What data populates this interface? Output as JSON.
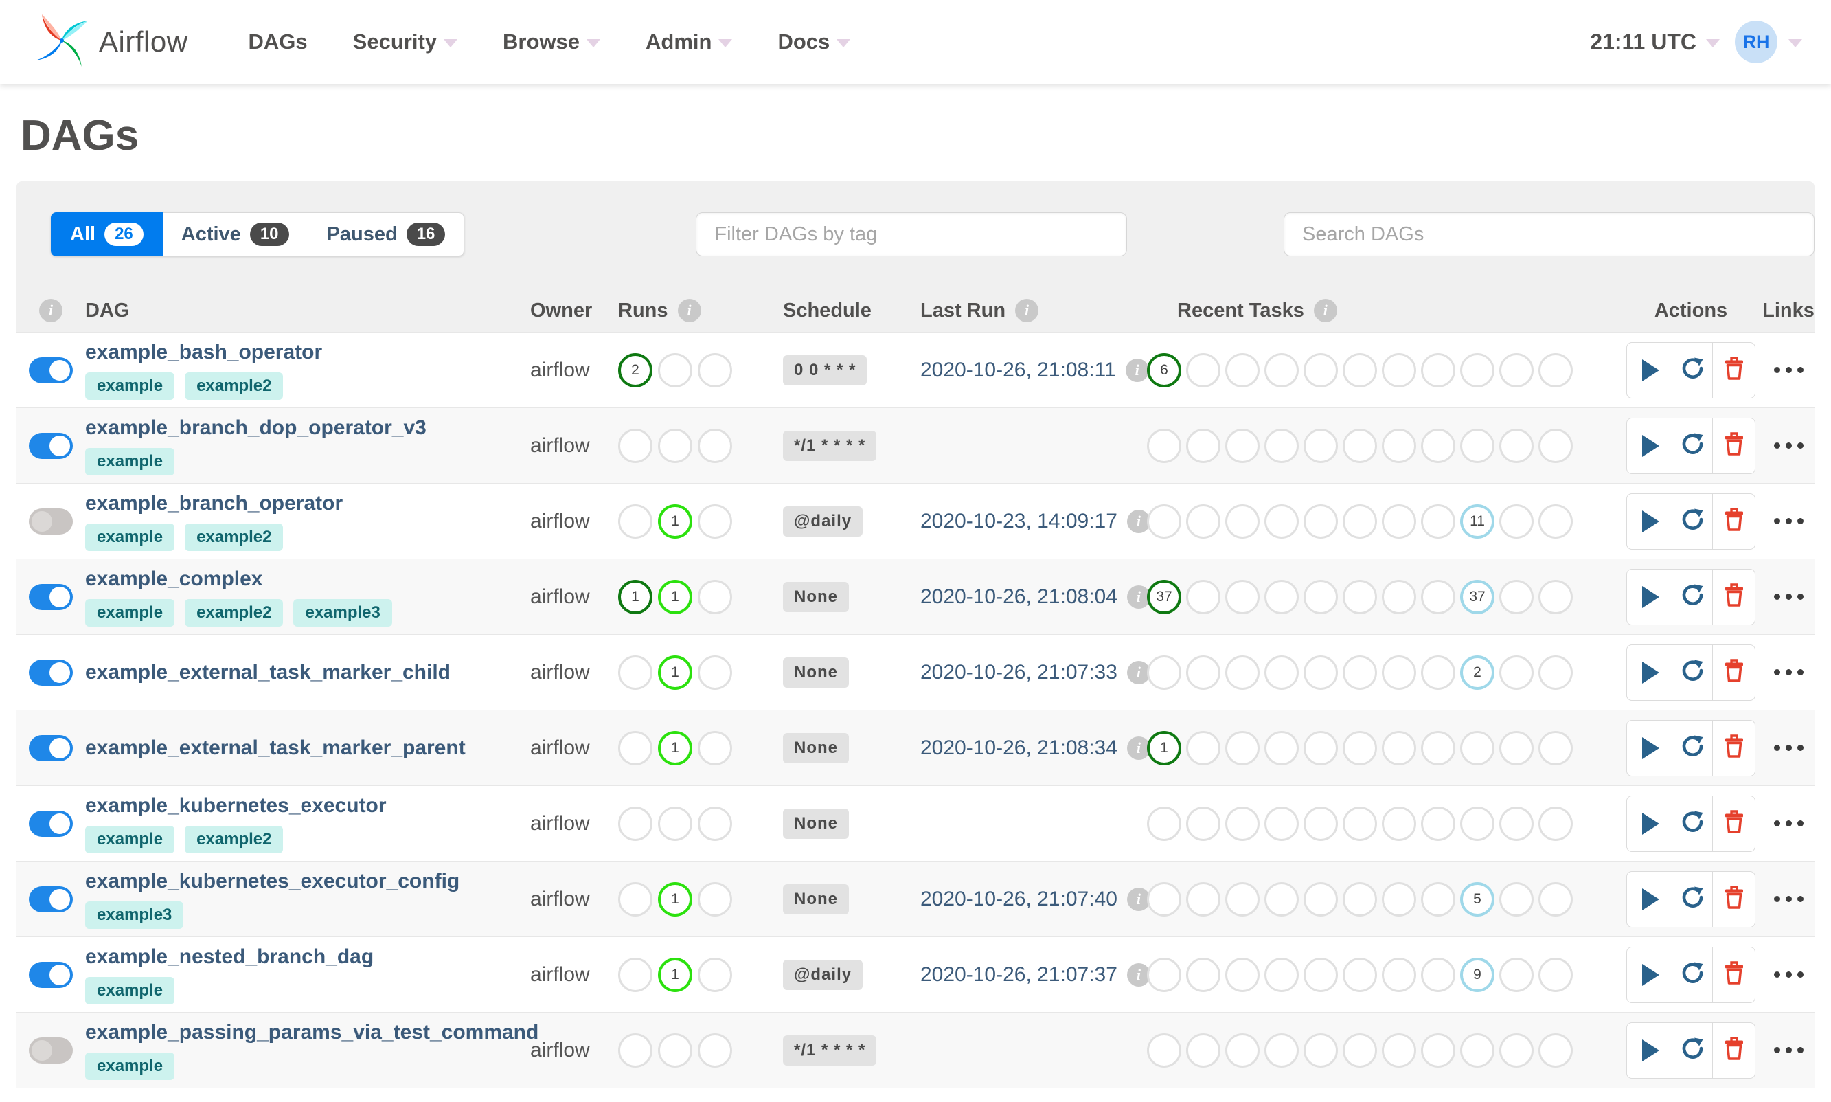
{
  "nav": {
    "brand": "Airflow",
    "items": [
      {
        "label": "DAGs",
        "caret": false
      },
      {
        "label": "Security",
        "caret": true
      },
      {
        "label": "Browse",
        "caret": true
      },
      {
        "label": "Admin",
        "caret": true
      },
      {
        "label": "Docs",
        "caret": true
      }
    ],
    "clock": "21:11 UTC",
    "avatar_initials": "RH"
  },
  "page": {
    "title": "DAGs"
  },
  "tabs": [
    {
      "label": "All",
      "count": "26",
      "active": true
    },
    {
      "label": "Active",
      "count": "10",
      "active": false
    },
    {
      "label": "Paused",
      "count": "16",
      "active": false
    }
  ],
  "filters": {
    "tag_placeholder": "Filter DAGs by tag",
    "search_placeholder": "Search DAGs"
  },
  "table": {
    "headers": {
      "dag": "DAG",
      "owner": "Owner",
      "runs": "Runs",
      "schedule": "Schedule",
      "last_run": "Last Run",
      "recent_tasks": "Recent Tasks",
      "actions": "Actions",
      "links": "Links"
    },
    "runs_states": [
      "success",
      "running",
      "failed"
    ],
    "recent_states": [
      "success",
      "running",
      "failed",
      "upstream_failed",
      "skipped",
      "up_for_retry",
      "up_for_reschedule",
      "queued",
      "none",
      "scheduled",
      "sensing"
    ],
    "rows": [
      {
        "dag_id": "example_bash_operator",
        "enabled": true,
        "tags": [
          "example",
          "example2"
        ],
        "owner": "airflow",
        "runs": {
          "success": "2"
        },
        "schedule": "0 0 * * *",
        "last_run": "2020-10-26, 21:08:11",
        "recent": {
          "success": "6"
        }
      },
      {
        "dag_id": "example_branch_dop_operator_v3",
        "enabled": true,
        "tags": [
          "example"
        ],
        "owner": "airflow",
        "runs": {},
        "schedule": "*/1 * * * *",
        "last_run": "",
        "recent": {}
      },
      {
        "dag_id": "example_branch_operator",
        "enabled": false,
        "tags": [
          "example",
          "example2"
        ],
        "owner": "airflow",
        "runs": {
          "running": "1"
        },
        "schedule": "@daily",
        "last_run": "2020-10-23, 14:09:17",
        "recent": {
          "none": "11"
        }
      },
      {
        "dag_id": "example_complex",
        "enabled": true,
        "tags": [
          "example",
          "example2",
          "example3"
        ],
        "owner": "airflow",
        "runs": {
          "success": "1",
          "running": "1"
        },
        "schedule": "None",
        "last_run": "2020-10-26, 21:08:04",
        "recent": {
          "success": "37",
          "none": "37"
        }
      },
      {
        "dag_id": "example_external_task_marker_child",
        "enabled": true,
        "tags": [],
        "owner": "airflow",
        "runs": {
          "running": "1"
        },
        "schedule": "None",
        "last_run": "2020-10-26, 21:07:33",
        "recent": {
          "none": "2"
        }
      },
      {
        "dag_id": "example_external_task_marker_parent",
        "enabled": true,
        "tags": [],
        "owner": "airflow",
        "runs": {
          "running": "1"
        },
        "schedule": "None",
        "last_run": "2020-10-26, 21:08:34",
        "recent": {
          "success": "1"
        }
      },
      {
        "dag_id": "example_kubernetes_executor",
        "enabled": true,
        "tags": [
          "example",
          "example2"
        ],
        "owner": "airflow",
        "runs": {},
        "schedule": "None",
        "last_run": "",
        "recent": {}
      },
      {
        "dag_id": "example_kubernetes_executor_config",
        "enabled": true,
        "tags": [
          "example3"
        ],
        "owner": "airflow",
        "runs": {
          "running": "1"
        },
        "schedule": "None",
        "last_run": "2020-10-26, 21:07:40",
        "recent": {
          "none": "5"
        }
      },
      {
        "dag_id": "example_nested_branch_dag",
        "enabled": true,
        "tags": [
          "example"
        ],
        "owner": "airflow",
        "runs": {
          "running": "1"
        },
        "schedule": "@daily",
        "last_run": "2020-10-26, 21:07:37",
        "recent": {
          "none": "9"
        }
      },
      {
        "dag_id": "example_passing_params_via_test_command",
        "enabled": false,
        "tags": [
          "example"
        ],
        "owner": "airflow",
        "runs": {},
        "schedule": "*/1 * * * *",
        "last_run": "",
        "recent": {}
      }
    ]
  },
  "colors": {
    "accent_blue": "#017cee",
    "toggle_on": "#1f87e8",
    "state_success": "#0f7912",
    "state_running": "#2ce10e",
    "state_none": "#9fd8e9",
    "tag_bg": "#cdf2ee",
    "trash_red": "#e5402c",
    "action_navy": "#29618b"
  }
}
